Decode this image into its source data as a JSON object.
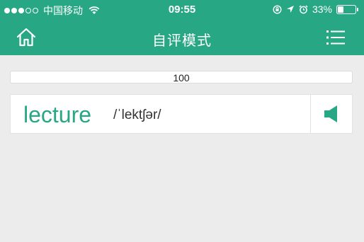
{
  "status_bar": {
    "carrier": "中国移动",
    "time": "09:55",
    "battery_percent": "33%",
    "battery_level": 0.33,
    "signal_bars_filled": 3,
    "signal_bars_total": 5
  },
  "navbar": {
    "title": "自评模式",
    "home_icon": "home-icon",
    "menu_icon": "list-menu-icon"
  },
  "progress": {
    "label": "100"
  },
  "word_card": {
    "word": "lecture",
    "phonetic": "/ˈlektʃər/",
    "speaker_icon": "speaker-icon"
  },
  "colors": {
    "brand_green": "#27a784",
    "background": "#ececed"
  }
}
